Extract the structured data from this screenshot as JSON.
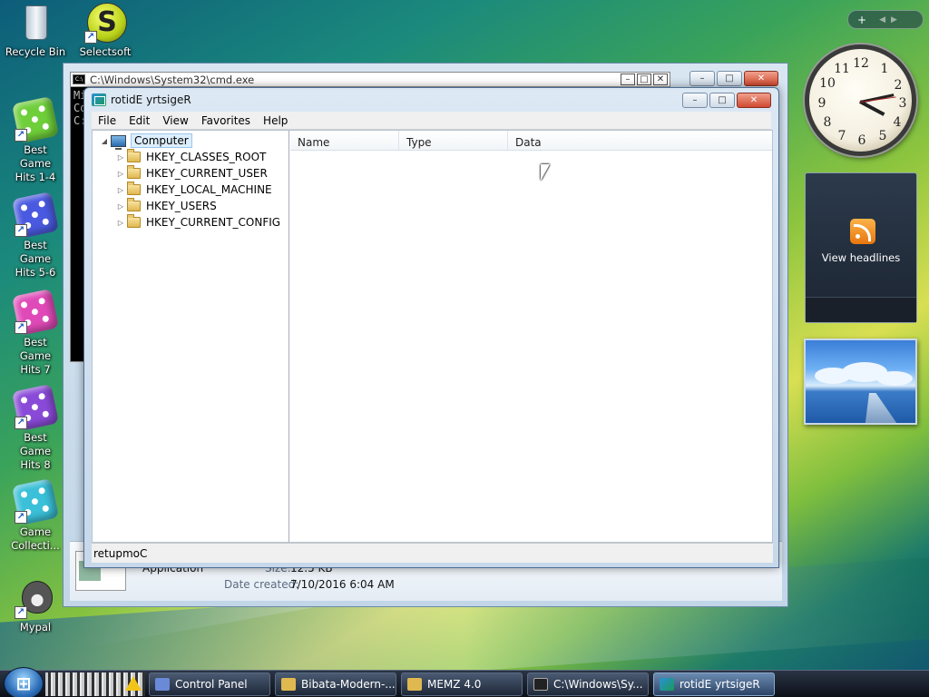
{
  "desktop": {
    "icons": [
      {
        "label": "Recycle Bin"
      },
      {
        "label": "Selectsoft"
      },
      {
        "label": "Best Game Hits 1-4"
      },
      {
        "label": "Best Game Hits 5-6"
      },
      {
        "label": "Best Game Hits 7"
      },
      {
        "label": "Best Game Hits 8"
      },
      {
        "label": "Game Collecti..."
      },
      {
        "label": "Mypal"
      }
    ]
  },
  "cmd_window": {
    "title": "C:\\Windows\\System32\\cmd.exe",
    "lines": [
      "Mi",
      "Co",
      "",
      "C:"
    ]
  },
  "details_pane": {
    "type_value": "Application",
    "size_label": "Size:",
    "size_value": "12.5 KB",
    "date_label": "Date created:",
    "date_value": "7/10/2016 6:04 AM"
  },
  "regedit": {
    "title": "rotidE yrtsigeR",
    "menu": [
      "File",
      "Edit",
      "View",
      "Favorites",
      "Help"
    ],
    "tree": {
      "root": "Computer",
      "keys": [
        "HKEY_CLASSES_ROOT",
        "HKEY_CURRENT_USER",
        "HKEY_LOCAL_MACHINE",
        "HKEY_USERS",
        "HKEY_CURRENT_CONFIG"
      ]
    },
    "columns": [
      "Name",
      "Type",
      "Data"
    ],
    "status": "retupmoC"
  },
  "gadgets": {
    "toolbar_add": "+",
    "feed_label": "View headlines",
    "clock_numbers": [
      "12",
      "1",
      "2",
      "3",
      "4",
      "5",
      "6",
      "7",
      "8",
      "9",
      "10",
      "11"
    ]
  },
  "taskbar": {
    "start_glyph": "⊞",
    "buttons": [
      {
        "label": "Control Panel",
        "icon_color": "#6a8ad8"
      },
      {
        "label": "Bibata-Modern-...",
        "icon_color": "#e0b850"
      },
      {
        "label": "MEMZ 4.0",
        "icon_color": "#e0b850"
      },
      {
        "label": "C:\\Windows\\Sy...",
        "icon_color": "#222222"
      },
      {
        "label": "rotidE yrtsigeR",
        "icon_color": "#2b8fd6"
      }
    ]
  }
}
